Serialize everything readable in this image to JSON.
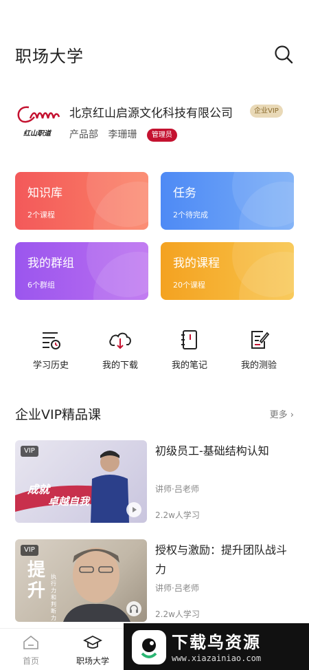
{
  "header": {
    "title": "职场大学"
  },
  "company": {
    "logo_text": "红山职道",
    "name": "北京红山启源文化科技有限公司",
    "vip_label": "企业VIP",
    "department": "产品部",
    "user": "李珊珊",
    "role": "管理员"
  },
  "cards": [
    {
      "title": "知识库",
      "sub": "2个课程"
    },
    {
      "title": "任务",
      "sub": "2个待完成"
    },
    {
      "title": "我的群组",
      "sub": "6个群组"
    },
    {
      "title": "我的课程",
      "sub": "20个课程"
    }
  ],
  "tools": [
    {
      "label": "学习历史",
      "icon": "history-icon"
    },
    {
      "label": "我的下载",
      "icon": "download-icon"
    },
    {
      "label": "我的笔记",
      "icon": "notebook-icon"
    },
    {
      "label": "我的测验",
      "icon": "quiz-icon"
    }
  ],
  "section": {
    "title": "企业VIP精品课",
    "more": "更多"
  },
  "courses": [
    {
      "vip": "VIP",
      "thumb_text_1": "成就",
      "thumb_text_2": "卓越自我",
      "title": "初级员工-基础结构认知",
      "teacher": "讲师·吕老师",
      "learners": "2.2w人学习"
    },
    {
      "vip": "VIP",
      "thumb_text_1": "提升",
      "thumb_text_2": "执行力和判断力",
      "title": "授权与激励：提升团队战斗力",
      "teacher": "讲师·吕老师",
      "learners": "2.2w人学习"
    }
  ],
  "nav": [
    {
      "label": "首页",
      "color": "#999999"
    },
    {
      "label": "职场大学",
      "color": "#222222"
    }
  ],
  "watermark": {
    "title": "下载鸟资源",
    "url": "www.xiazainiao.com"
  },
  "colors": {
    "accent_red": "#c41230",
    "vip_gold": "#e9d9b7"
  }
}
